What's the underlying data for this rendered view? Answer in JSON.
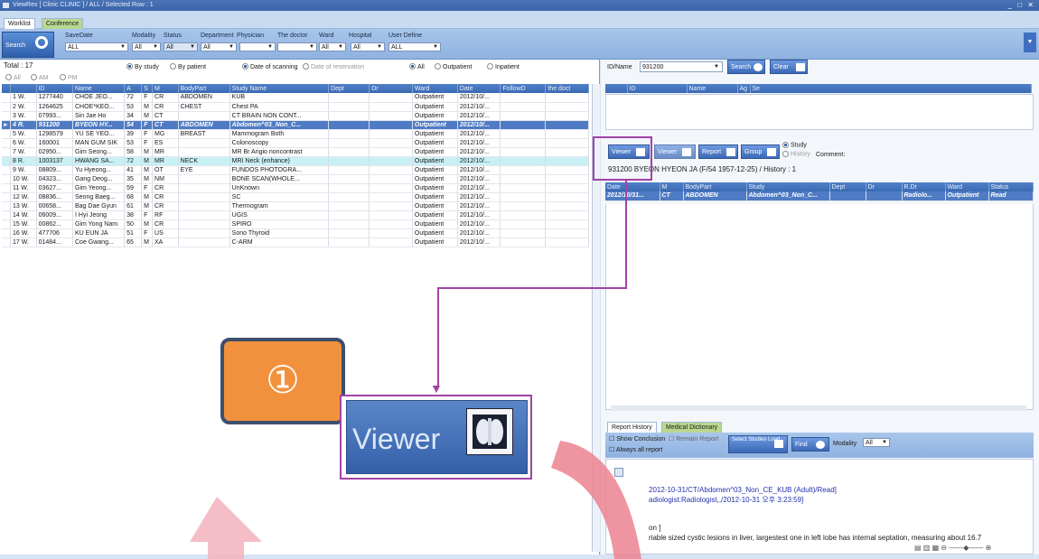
{
  "window": {
    "title": "ViewRex  [ Clinic CLINIC ]  /  ALL / Selected Row : 1",
    "controls": "_ □ ✕"
  },
  "tabs": [
    {
      "label": "Worklist"
    },
    {
      "label": "Conference"
    }
  ],
  "filters": {
    "search_label": "Search",
    "savedate_label": "SaveDate",
    "savedate_value": "ALL",
    "modality_label": "Modality",
    "modality_value": "All",
    "status_label": "Status",
    "status_value": "All",
    "department_label": "Department",
    "department_value": "All",
    "physician_label": "Physician",
    "doctor_label": "The doctor",
    "ward_label": "Ward",
    "ward_value": "All",
    "hospital_label": "Hospital",
    "hospital_value": "All",
    "userdefine_label": "User Define",
    "userdefine_value": "ALL"
  },
  "worklist": {
    "total": "Total : 17",
    "by_study": "By study",
    "by_patient": "By patient",
    "date_scanning": "Date of scanning",
    "date_reservation": "Date of reservation",
    "all": "All",
    "outpatient": "Outpatient",
    "inpatient": "Inpatient",
    "ampm_all": "All",
    "am": "AM",
    "pm": "PM",
    "columns": [
      "",
      "",
      "ID",
      "Name",
      "A",
      "S",
      "M",
      "BodyPart",
      "Study Name",
      "Dept",
      "Dr",
      "Ward",
      "Date",
      "FollowD",
      "the doct"
    ],
    "rows": [
      [
        "",
        "1 W.",
        "1277440",
        "CHOE JEO...",
        "72",
        "F",
        "CR",
        "ABDOMEN",
        "KUB",
        "",
        "",
        "Outpatient",
        "2012/10/...",
        "",
        ""
      ],
      [
        "",
        "2 W.",
        "1264625",
        "CHOE*KEO...",
        "53",
        "M",
        "CR",
        "CHEST",
        "Chest PA",
        "",
        "",
        "Outpatient",
        "2012/10/...",
        "",
        ""
      ],
      [
        "",
        "3 W.",
        "07993...",
        "Sin Jae Ho",
        "34",
        "M",
        "CT",
        "",
        "CT BRAIN NON CONT...",
        "",
        "",
        "Outpatient",
        "2012/10/...",
        "",
        ""
      ],
      [
        "▸",
        "4 R.",
        "931200",
        "BYEON HY...",
        "54",
        "F",
        "CT",
        "ABDOMEN",
        "Abdomen^03_Non_C...",
        "",
        "",
        "Outpatient",
        "2012/10/...",
        "",
        ""
      ],
      [
        "",
        "5 W.",
        "1298579",
        "YU SE YEO...",
        "39",
        "F",
        "MG",
        "BREAST",
        "Mammogram Both",
        "",
        "",
        "Outpatient",
        "2012/10/...",
        "",
        ""
      ],
      [
        "",
        "6 W.",
        "160001",
        "MAN GUM SIK",
        "53",
        "F",
        "ES",
        "",
        "Colonoscopy",
        "",
        "",
        "Outpatient",
        "2012/10/...",
        "",
        ""
      ],
      [
        "",
        "7 W.",
        "02950...",
        "Gim Seong...",
        "58",
        "M",
        "MR",
        "",
        "MR Br Angio noncontrast",
        "",
        "",
        "Outpatient",
        "2012/10/...",
        "",
        ""
      ],
      [
        "",
        "8 R.",
        "1003137",
        "HWANG SA...",
        "72",
        "M",
        "MR",
        "NECK",
        "MRI Neck (enhance)",
        "",
        "",
        "Outpatient",
        "2012/10/...",
        "",
        ""
      ],
      [
        "",
        "9 W.",
        "08809...",
        "Yu Hyeong...",
        "41",
        "M",
        "OT",
        "EYE",
        "FUNDOS PHOTOGRA...",
        "",
        "",
        "Outpatient",
        "2012/10/...",
        "",
        ""
      ],
      [
        "",
        "10 W.",
        "04323...",
        "Gang Deog...",
        "35",
        "M",
        "NM",
        "",
        "BONE SCAN(WHOLE...",
        "",
        "",
        "Outpatient",
        "2012/10/...",
        "",
        ""
      ],
      [
        "",
        "11 W.",
        "03627...",
        "Gim Yeong...",
        "59",
        "F",
        "CR",
        "",
        "UnKnown",
        "",
        "",
        "Outpatient",
        "2012/10/...",
        "",
        ""
      ],
      [
        "",
        "12 W.",
        "08836...",
        "Seong Baeg...",
        "68",
        "M",
        "CR",
        "",
        "SC",
        "",
        "",
        "Outpatient",
        "2012/10/...",
        "",
        ""
      ],
      [
        "",
        "13 W.",
        "00658...",
        "Bag Dae Gyun",
        "61",
        "M",
        "CR",
        "",
        "Thermogram",
        "",
        "",
        "Outpatient",
        "2012/10/...",
        "",
        ""
      ],
      [
        "",
        "14 W.",
        "06009...",
        "I Hyi Jeong",
        "38",
        "F",
        "RF",
        "",
        "UGIS",
        "",
        "",
        "Outpatient",
        "2012/10/...",
        "",
        ""
      ],
      [
        "",
        "15 W.",
        "00862...",
        "Gim Yong Nam",
        "50",
        "M",
        "CR",
        "",
        "SPIRO",
        "",
        "",
        "Outpatient",
        "2012/10/...",
        "",
        ""
      ],
      [
        "",
        "16 W.",
        "477706",
        "KU EUN JA",
        "51",
        "F",
        "US",
        "",
        "Sono Thyroid",
        "",
        "",
        "Outpatient",
        "2012/10/...",
        "",
        ""
      ],
      [
        "",
        "17 W.",
        "01484...",
        "Coe Gwang...",
        "65",
        "M",
        "XA",
        "",
        "C-ARM",
        "",
        "",
        "Outpatient",
        "2012/10/...",
        "",
        ""
      ]
    ]
  },
  "right": {
    "idname_label": "ID/Name",
    "idname_value": "931200",
    "search_label": "Search",
    "clear_label": "Clear",
    "top_columns": [
      "",
      "ID",
      "Name",
      "Ag",
      "Se"
    ],
    "viewer_label": "Viewer",
    "viewer2_label": "Viewer",
    "report_label": "Report",
    "group_label": "Group",
    "study_label": "Study",
    "history_label": "History",
    "comment_label": "Comment:",
    "patient_info": "931200 BYEON HYEON JA (F/54 1957-12-25)  / History : 1",
    "history_columns": [
      "Date",
      "M",
      "BodyPart",
      "Study",
      "Dept",
      "Dr",
      "R.Dr",
      "Ward",
      "Status"
    ],
    "history_rows": [
      [
        "2012/10/31...",
        "CT",
        "ABDOMEN",
        "Abdomen^03_Non_C...",
        "",
        "",
        "Radiolo...",
        "Outpatient",
        "Read"
      ]
    ],
    "report_tab": "Report History",
    "dictionary_tab": "Medical Dictionary",
    "show_conclusion": "Show Conclusion",
    "remain_report": "Remain Report",
    "always_report": "Always all report",
    "select_studies": "Select Studies Load",
    "find_label": "Find",
    "modality_label": "Modality",
    "modality_value": "All",
    "report_line1": "2012-10-31/CT/Abdomen^03_Non_CE_KUB (Adult)/Read]",
    "report_line2": "adiologist:Radiologist,,/2012-10-31 오후 3:23:59]",
    "report_line3": "on ]",
    "report_line4": "riable sized cystic lesions in liver, largestest one in left lobe has internal septation, measuring about 16.7"
  },
  "annotation": {
    "badge": "①",
    "zoom_label": "Viewer",
    "accent": "#a243a6",
    "badge_color": "#f2913d"
  }
}
